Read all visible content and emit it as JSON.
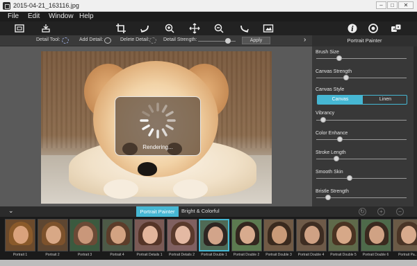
{
  "window": {
    "title": "2015-04-21_163116.jpg"
  },
  "menu": [
    "File",
    "Edit",
    "Window",
    "Help"
  ],
  "toolbar": {
    "icons": [
      "fit-screen",
      "save",
      "crop",
      "undo",
      "zoom-in",
      "pan",
      "zoom-out",
      "redo",
      "compare",
      "info",
      "settings",
      "dice"
    ]
  },
  "options": {
    "detail_tool": "Detail Tool:",
    "add_detail": "Add Detail:",
    "delete_detail": "Delete Detail:",
    "detail_strength": "Detail Strength:",
    "detail_strength_level": 0.8,
    "apply": "Apply"
  },
  "canvas": {
    "rendering_text": "Rendering..."
  },
  "panel": {
    "title": "Portrait Painter",
    "controls": [
      {
        "label": "Brush Size",
        "value": 0.25
      },
      {
        "label": "Canvas Strength",
        "value": 0.33
      },
      {
        "label": "Vibrancy",
        "value": 0.08
      },
      {
        "label": "Color Enhance",
        "value": 0.26
      },
      {
        "label": "Stroke Length",
        "value": 0.22
      },
      {
        "label": "Smooth Skin",
        "value": 0.37
      },
      {
        "label": "Bristle Strength",
        "value": 0.13
      }
    ],
    "canvas_style": {
      "label": "Canvas Style",
      "options": [
        "Canvas",
        "Linen"
      ],
      "selected": "Canvas"
    }
  },
  "bottom": {
    "tabs": [
      "Portrait Painter",
      "Bright & Colorful"
    ],
    "active_tab": "Portrait Painter",
    "presets": [
      {
        "name": "Portrait 1",
        "bg": "#6b4a2c",
        "face": "#d9a27c",
        "hair": "#8a5a2a"
      },
      {
        "name": "Portrait 2",
        "bg": "#5e4631",
        "face": "#d8a886",
        "hair": "#7d522c"
      },
      {
        "name": "Portrait 3",
        "bg": "#3b5a3f",
        "face": "#c9977a",
        "hair": "#6b4a36"
      },
      {
        "name": "Portrait 4",
        "bg": "#4d5a47",
        "face": "#d3a382",
        "hair": "#5c3d2a"
      },
      {
        "name": "Portrait Details 1",
        "bg": "#7a5a55",
        "face": "#e3b59c",
        "hair": "#553528"
      },
      {
        "name": "Portrait Details 2",
        "bg": "#806060",
        "face": "#e4b9a3",
        "hair": "#5a3a2c"
      },
      {
        "name": "Portrait Double 1",
        "bg": "#4f6a55",
        "face": "#d2a48a",
        "hair": "#2e2622"
      },
      {
        "name": "Portrait Double 2",
        "bg": "#5c7a50",
        "face": "#d8ab8e",
        "hair": "#33271f"
      },
      {
        "name": "Portrait Double 3",
        "bg": "#705a45",
        "face": "#c99a78",
        "hair": "#3a2a1e"
      },
      {
        "name": "Portrait Double 4",
        "bg": "#6e5a48",
        "face": "#cfa184",
        "hair": "#3e2d22"
      },
      {
        "name": "Portrait Double 5",
        "bg": "#5f6a4a",
        "face": "#d6a888",
        "hair": "#4a3322"
      },
      {
        "name": "Portrait Double 6",
        "bg": "#4e6a4a",
        "face": "#d0a284",
        "hair": "#3a2a1f"
      },
      {
        "name": "Portrait Pa...",
        "bg": "#6a5a46",
        "face": "#d7aa8c",
        "hair": "#4a3526"
      }
    ],
    "selected_preset": "Portrait Double 1"
  },
  "colors": {
    "accent": "#46b7d3"
  }
}
